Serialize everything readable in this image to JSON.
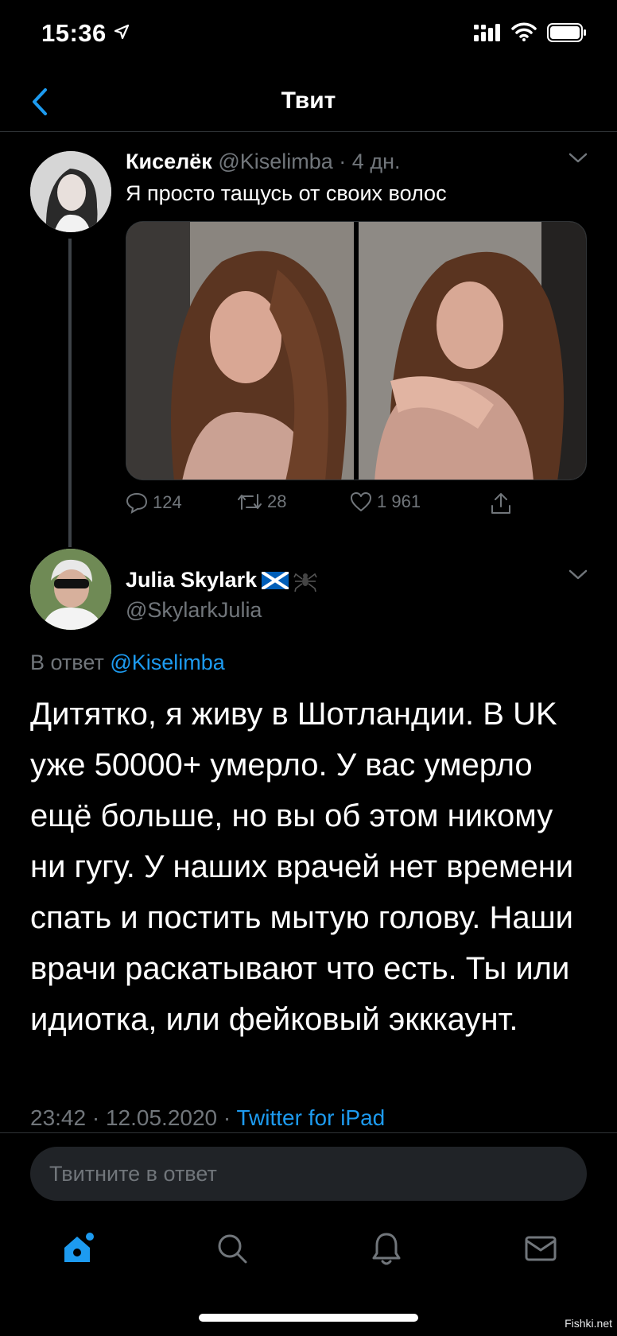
{
  "status_bar": {
    "time": "15:36"
  },
  "nav": {
    "title": "Твит"
  },
  "tweet1": {
    "name": "Киселёк",
    "handle": "@Kiselimba",
    "separator": "·",
    "age": "4 дн.",
    "text": "Я просто тащусь от своих волос",
    "replies": "124",
    "retweets": "28",
    "likes": "1 961"
  },
  "tweet2": {
    "name": "Julia Skylark",
    "handle": "@SkylarkJulia",
    "reply_prefix": "В ответ",
    "reply_to": "@Kiselimba",
    "text": "Дитятко, я живу в Шотландии. В UK уже 50000+ умерло. У вас умерло ещё больше, но вы об этом никому ни гугу. У наших врачей нет времени спать и постить мытую голову. Наши врачи раскатывают что есть. Ты или идиотка, или фейковый экккаунт.",
    "time": "23:42",
    "separator": "·",
    "date": "12.05.2020",
    "source": "Twitter for iPad"
  },
  "reply_box": {
    "placeholder": "Твитните в ответ"
  },
  "watermark": "Fishki.net",
  "colors": {
    "accent": "#1d9bf0",
    "background": "#000000",
    "muted": "#71767b"
  }
}
